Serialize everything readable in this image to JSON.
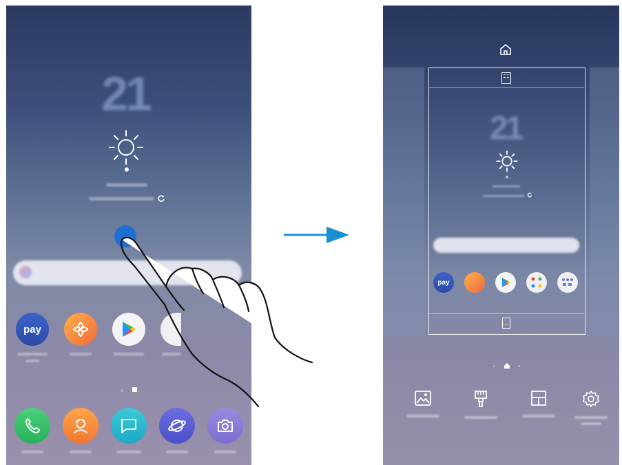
{
  "before": {
    "weather": {
      "temperature": "21"
    },
    "dock_apps": [
      "phone-icon",
      "contacts-icon",
      "messages-icon",
      "internet-icon",
      "camera-icon"
    ],
    "home_apps": [
      "pay-icon",
      "gallery-icon",
      "play-store-icon"
    ]
  },
  "transition": {
    "arrow": "arrow-right-icon"
  },
  "after": {
    "weather": {
      "temperature": "21"
    },
    "apps": [
      "pay-icon",
      "gallery-icon",
      "play-store-icon",
      "google-folder-icon",
      "samsung-folder-icon"
    ],
    "toolbar": [
      "wallpapers-icon",
      "themes-icon",
      "widgets-icon",
      "settings-icon"
    ]
  },
  "labels": {
    "pay": "pay"
  },
  "colors": {
    "arrow": "#1a8fd6",
    "touch": "#1f6fd0"
  }
}
